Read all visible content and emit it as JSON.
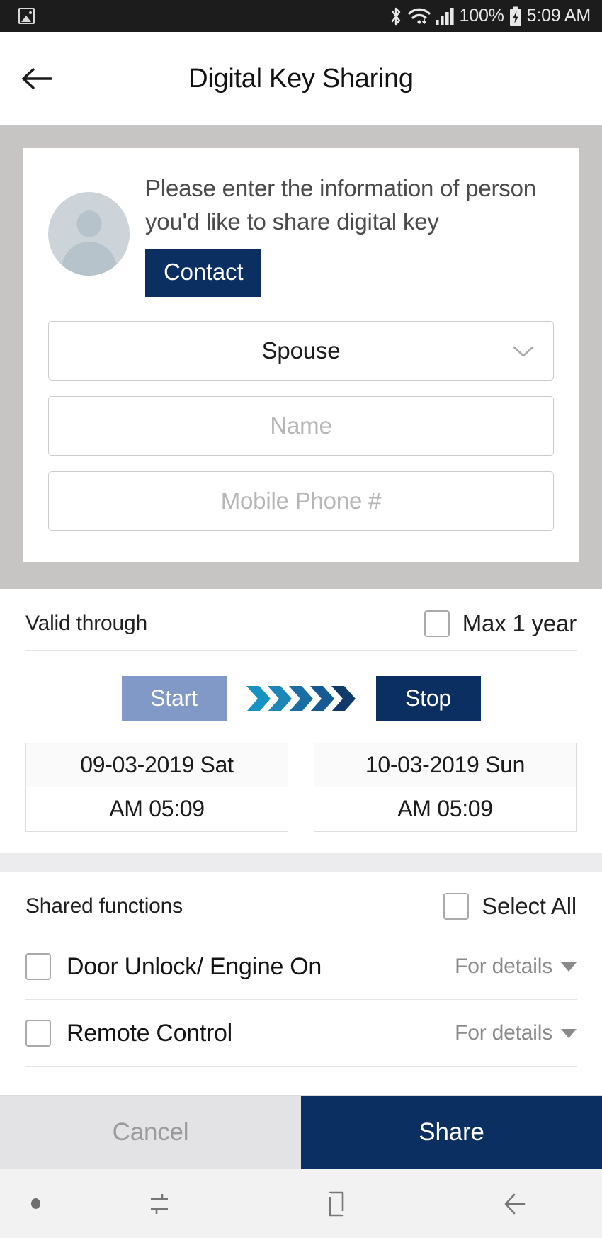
{
  "statusbar": {
    "gallery_icon": "gallery-icon",
    "bluetooth_icon": "bluetooth-icon",
    "wifi_icon": "wifi-icon",
    "signal_icon": "cellular-signal-icon",
    "battery_percent": "100%",
    "battery_icon": "battery-charging-icon",
    "time": "5:09 AM"
  },
  "appbar": {
    "back_icon": "back-arrow-icon",
    "title": "Digital Key Sharing"
  },
  "card": {
    "avatar_icon": "person-avatar-icon",
    "instruction": "Please enter the information of person you'd like to share digital key",
    "contact_button": "Contact",
    "relation_select": {
      "value": "Spouse",
      "chevron_icon": "chevron-down-icon"
    },
    "name_input": {
      "value": "",
      "placeholder": "Name"
    },
    "phone_input": {
      "value": "",
      "placeholder": "Mobile Phone #"
    }
  },
  "valid_through": {
    "title": "Valid through",
    "max_checkbox_label": "Max 1 year",
    "max_checked": false,
    "start_button": "Start",
    "stop_button": "Stop",
    "arrows_icon": "chevron-progress-icon",
    "start_date": "09-03-2019 Sat",
    "start_time": "AM 05:09",
    "stop_date": "10-03-2019 Sun",
    "stop_time": "AM 05:09"
  },
  "shared_functions": {
    "title": "Shared functions",
    "select_all_label": "Select All",
    "select_all_checked": false,
    "details_label": "For details",
    "items": [
      {
        "label": "Door Unlock/ Engine On",
        "checked": false,
        "details": "For details"
      },
      {
        "label": "Remote Control",
        "checked": false,
        "details": "For details"
      }
    ]
  },
  "actions": {
    "cancel": "Cancel",
    "share": "Share"
  },
  "navbar": {
    "dot_icon": "notification-dot-icon",
    "recents_icon": "recents-icon",
    "home_icon": "home-icon",
    "back_icon": "nav-back-icon"
  },
  "colors": {
    "brand_navy": "#0c2f62",
    "start_blue": "#8099c7",
    "arrow_light": "#1793c3",
    "arrow_dark": "#0f3a6b",
    "gray_band": "#c6c5c3"
  }
}
